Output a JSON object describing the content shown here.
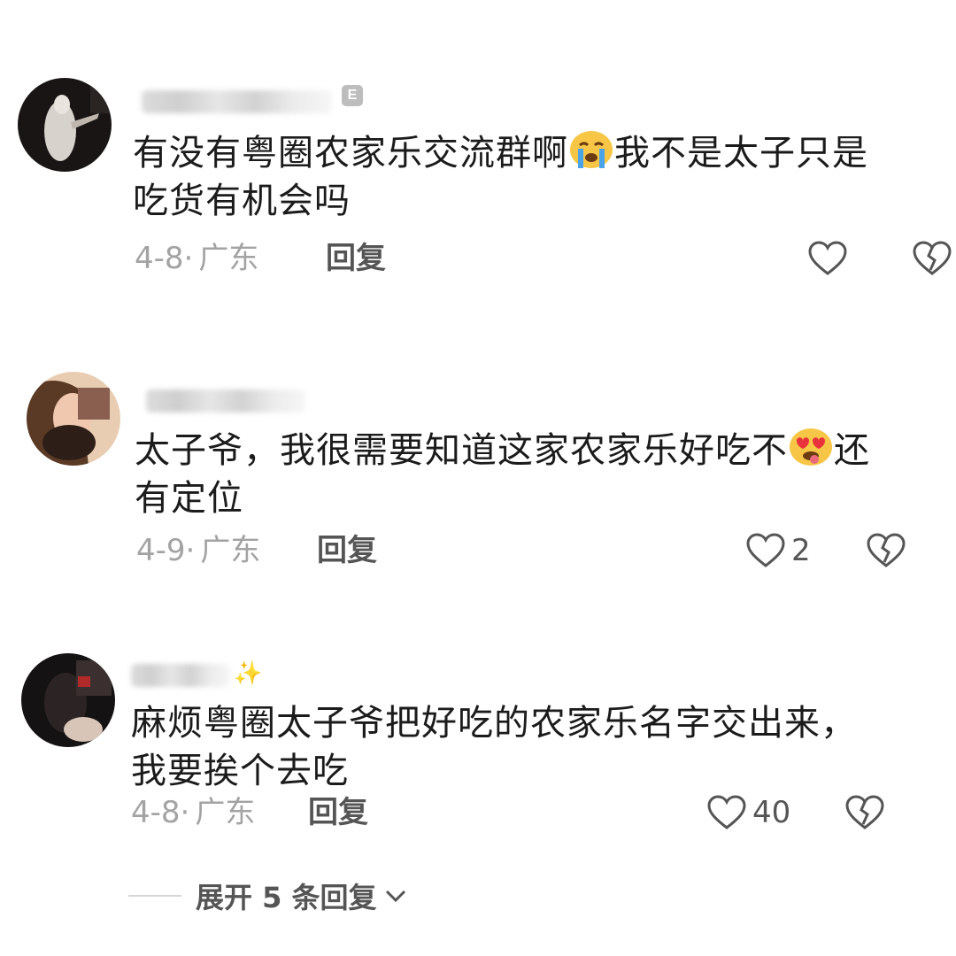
{
  "comments": [
    {
      "text_line1": "有没有粤圈农家乐交流群啊",
      "text_line1_after": "我不是太子只是",
      "text_line2": "吃货有机会吗",
      "emoji": "crying-face",
      "date": "4-8·",
      "location": "广东",
      "reply_label": "回复",
      "badge": "E",
      "like_count": ""
    },
    {
      "text_line1": "太子爷，我很需要知道这家农家乐好吃不",
      "text_line1_after": "还",
      "text_line2": "有定位",
      "emoji": "heart-eyes-tongue-face",
      "date": "4-9·",
      "location": "广东",
      "reply_label": "回复",
      "like_count": "2"
    },
    {
      "text_line1": "麻烦粤圈太子爷把好吃的农家乐名字交出来，",
      "text_line2": "我要挨个去吃",
      "date": "4-8·",
      "location": "广东",
      "reply_label": "回复",
      "like_count": "40",
      "sparkle": "sparkle-icon"
    }
  ],
  "expand_replies": "展开 5 条回复",
  "colors": {
    "text": "#1b1b1b",
    "meta": "#a3a3a3",
    "action": "#555555",
    "emoji_yellow": "#f7c646",
    "tear_blue": "#4aa3e8"
  }
}
